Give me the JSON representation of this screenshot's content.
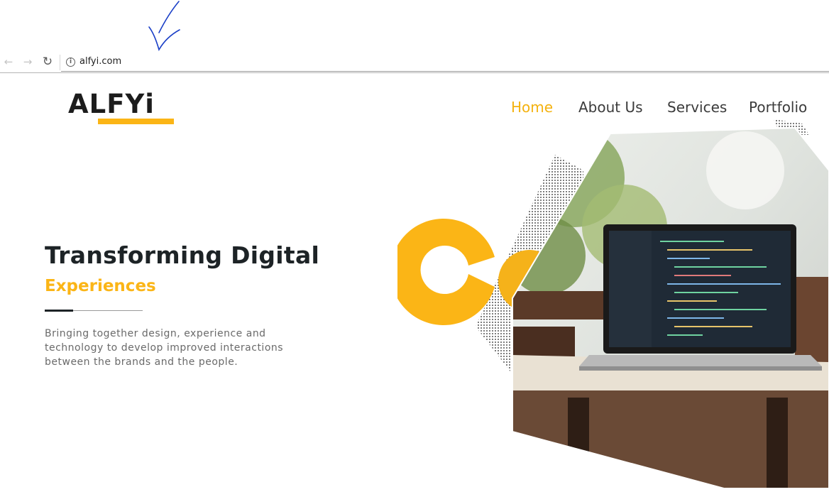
{
  "browser": {
    "url": "alfyi.com",
    "icons": {
      "back": "arrow-left-icon",
      "forward": "arrow-right-icon",
      "reload": "reload-icon",
      "info": "info-icon"
    }
  },
  "site": {
    "logo": "ALFYi",
    "nav": [
      {
        "label": "Home",
        "active": true
      },
      {
        "label": "About Us",
        "active": false
      },
      {
        "label": "Services",
        "active": false
      },
      {
        "label": "Portfolio",
        "active": false
      }
    ]
  },
  "hero": {
    "title": "Transforming Digital",
    "subtitle": "Experiences",
    "description_lines": [
      "Bringing together design, experience and",
      "technology to develop improved interactions",
      "between the brands and the people."
    ]
  },
  "colors": {
    "accent": "#fbb516",
    "dark": "#1d2326",
    "text_muted": "#6a6a6a"
  }
}
